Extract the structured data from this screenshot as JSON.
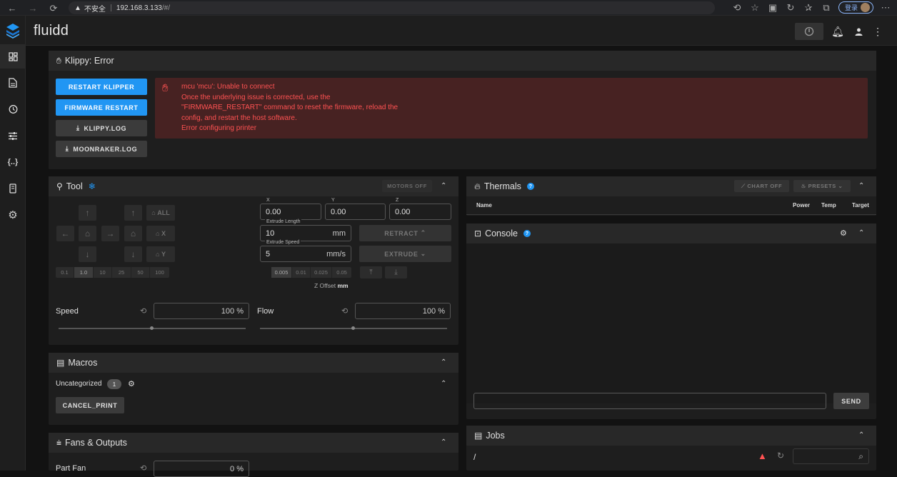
{
  "browser": {
    "security_label": "不安全",
    "url_host": "192.168.3.133",
    "url_path": "/#/",
    "login_label": "登录"
  },
  "app": {
    "title": "fluidd"
  },
  "sidebar": {
    "items": [
      "dashboard-icon",
      "files-icon",
      "history-icon",
      "tune-icon",
      "config-icon",
      "system-icon",
      "settings-icon"
    ]
  },
  "klippy": {
    "header": "Klippy: Error",
    "buttons": {
      "restart_klipper": "RESTART KLIPPER",
      "firmware_restart": "FIRMWARE RESTART",
      "klippy_log": "KLIPPY.LOG",
      "moonraker_log": "MOONRAKER.LOG"
    },
    "error_lines": [
      "mcu 'mcu': Unable to connect",
      "Once the underlying issue is corrected, use the",
      "\"FIRMWARE_RESTART\" command to reset the firmware, reload the",
      "config, and restart the host software.",
      "Error configuring printer"
    ]
  },
  "tool": {
    "header": "Tool",
    "motors_off": "MOTORS OFF",
    "home_all": "ALL",
    "home_x": "X",
    "home_y": "Y",
    "steps": [
      "0.1",
      "1.0",
      "10",
      "25",
      "50",
      "100"
    ],
    "selected_step": "1.0",
    "pos": {
      "x_label": "X",
      "x_value": "0.00",
      "y_label": "Y",
      "y_value": "0.00",
      "z_label": "Z",
      "z_value": "0.00"
    },
    "extrude_length_label": "Extrude Length",
    "extrude_length_value": "10",
    "extrude_length_unit": "mm",
    "extrude_speed_label": "Extrude Speed",
    "extrude_speed_value": "5",
    "extrude_speed_unit": "mm/s",
    "retract_label": "RETRACT",
    "extrude_label": "EXTRUDE",
    "z_steps": [
      "0.005",
      "0.01",
      "0.025",
      "0.05"
    ],
    "z_selected": "0.005",
    "z_offset_label": "Z Offset",
    "z_offset_unit": "mm",
    "speed_label": "Speed",
    "speed_value": "100 %",
    "flow_label": "Flow",
    "flow_value": "100 %"
  },
  "thermals": {
    "header": "Thermals",
    "chart_off": "CHART OFF",
    "presets": "PRESETS",
    "columns": [
      "Name",
      "Power",
      "Temp",
      "Target"
    ]
  },
  "console": {
    "header": "Console",
    "send_label": "SEND"
  },
  "macros": {
    "header": "Macros",
    "group_label": "Uncategorized",
    "group_count": "1",
    "items": [
      "CANCEL_PRINT"
    ]
  },
  "fans": {
    "header": "Fans & Outputs",
    "part_fan_label": "Part Fan",
    "part_fan_value": "0 %"
  },
  "jobs": {
    "header": "Jobs",
    "path": "/"
  }
}
